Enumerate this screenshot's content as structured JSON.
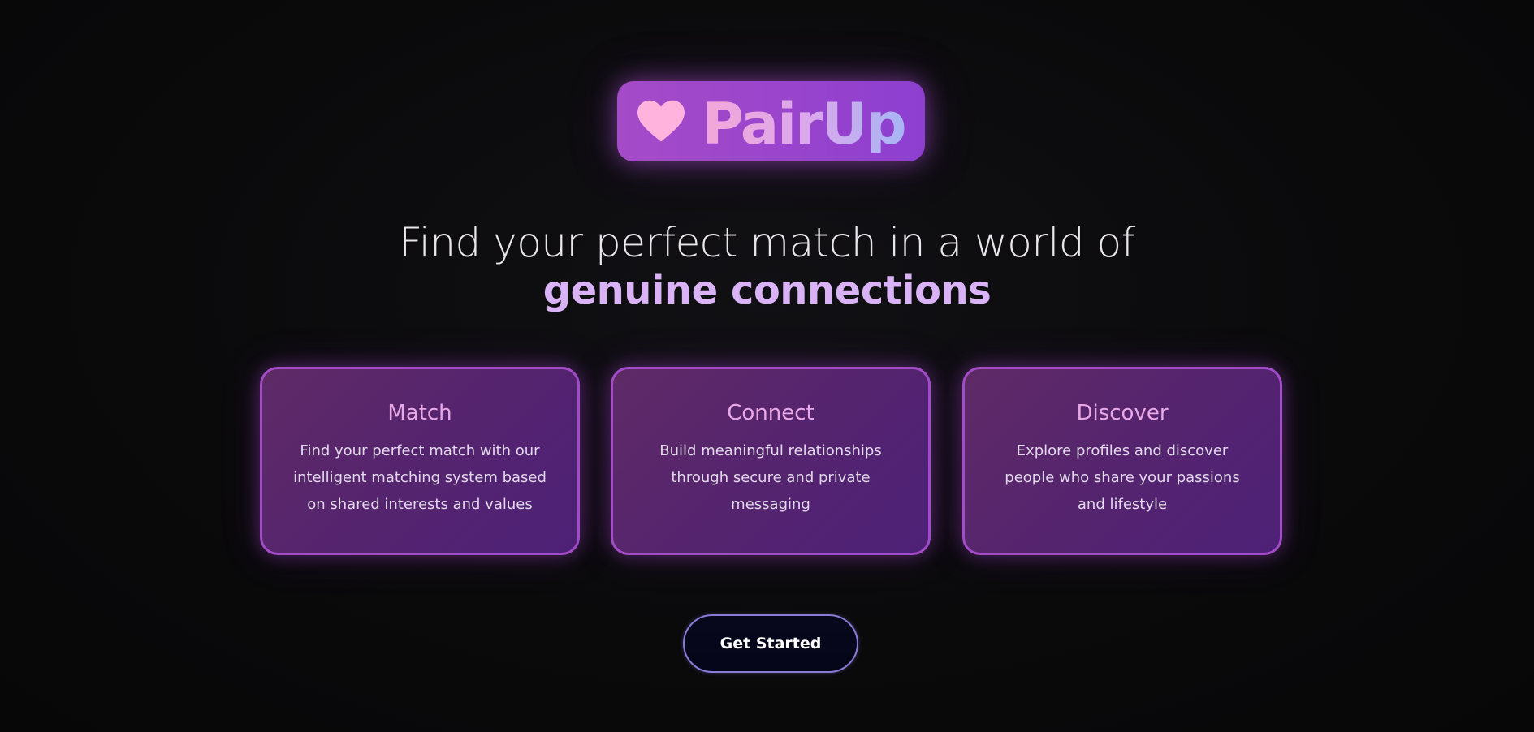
{
  "brand": {
    "name": "PairUp",
    "logo_icon": "heart-icon"
  },
  "hero": {
    "line1": "Find your perfect match in a world of",
    "line2": "genuine connections"
  },
  "features": [
    {
      "title": "Match",
      "description": "Find your perfect match with our intelligent matching system based on shared interests and values"
    },
    {
      "title": "Connect",
      "description": "Build meaningful relationships through secure and private messaging"
    },
    {
      "title": "Discover",
      "description": "Explore profiles and discover people who share your passions and lifestyle"
    }
  ],
  "cta": {
    "label": "Get Started"
  },
  "colors": {
    "background": "#0a0a0b",
    "accent_purple": "#a34cc8",
    "highlight_text": "#d9b3f5",
    "heart": "#ffb3dd"
  }
}
